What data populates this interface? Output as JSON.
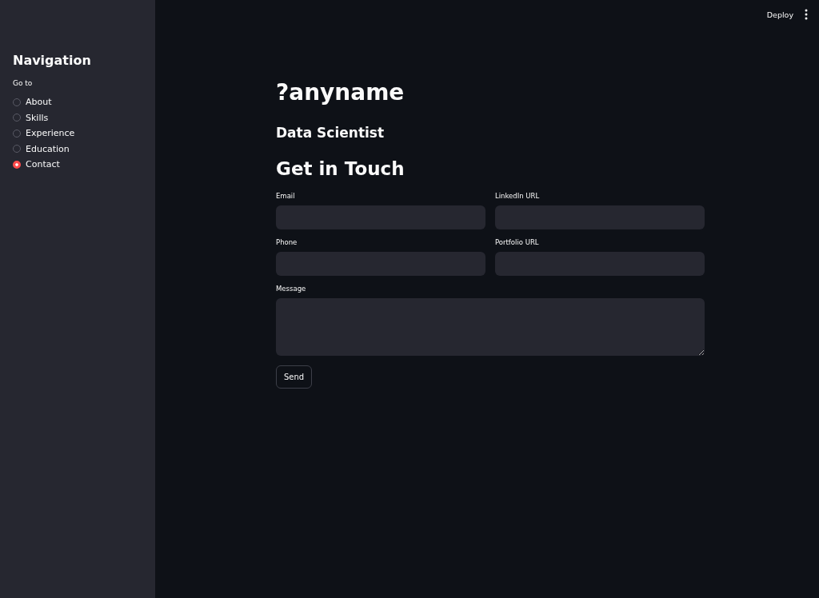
{
  "header": {
    "deploy": "Deploy"
  },
  "sidebar": {
    "title": "Navigation",
    "group_label": "Go to",
    "options": [
      {
        "label": "About",
        "selected": false
      },
      {
        "label": "Skills",
        "selected": false
      },
      {
        "label": "Experience",
        "selected": false
      },
      {
        "label": "Education",
        "selected": false
      },
      {
        "label": "Contact",
        "selected": true
      }
    ]
  },
  "main": {
    "name": "?anyname",
    "subtitle": "Data Scientist",
    "section": "Get in Touch",
    "fields": [
      {
        "label": "Email",
        "kind": "input"
      },
      {
        "label": "LinkedIn URL",
        "kind": "input"
      },
      {
        "label": "Phone",
        "kind": "input"
      },
      {
        "label": "Portfolio URL",
        "kind": "input"
      },
      {
        "label": "Message",
        "kind": "textarea"
      }
    ],
    "button": "Send"
  }
}
